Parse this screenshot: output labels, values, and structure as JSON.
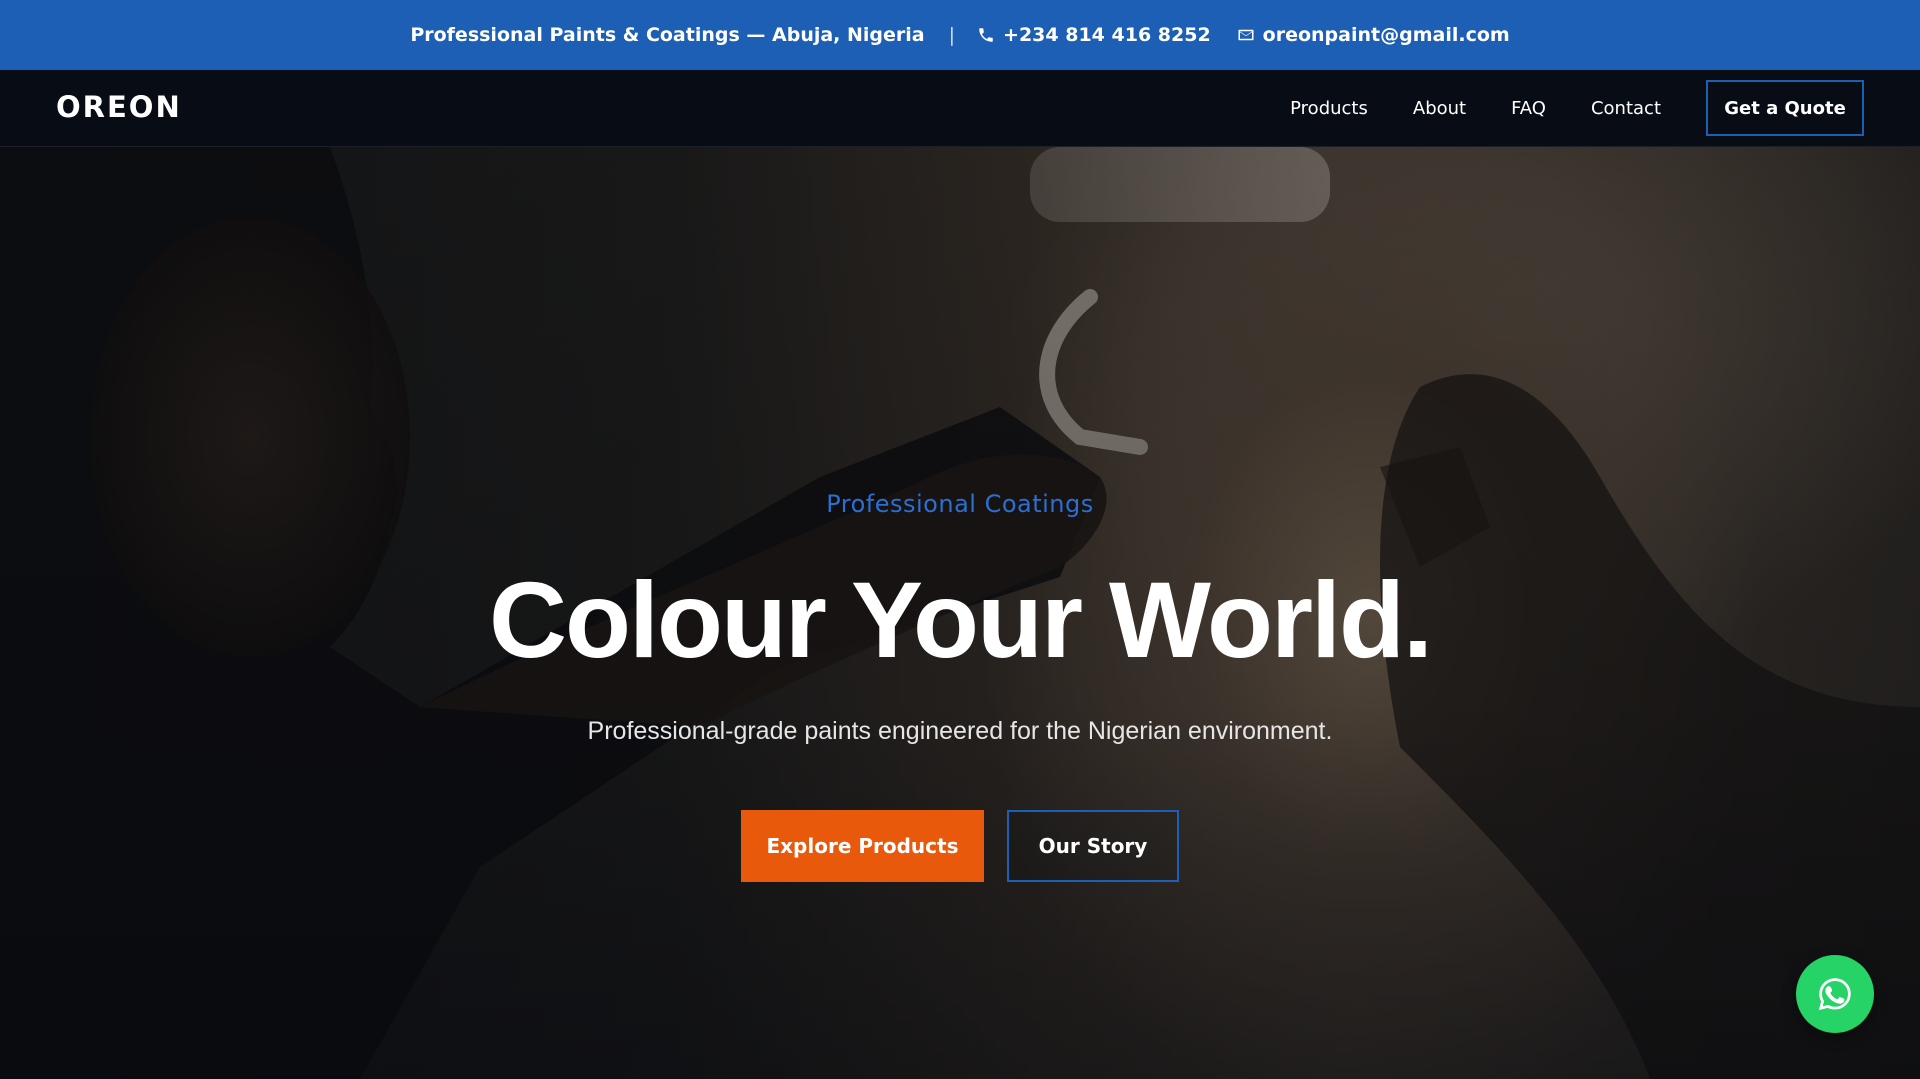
{
  "topbar": {
    "tagline": "Professional Paints & Coatings — Abuja, Nigeria",
    "separator": "|",
    "phone": "+234 814 416 8252",
    "phone_icon": "phone-icon",
    "email": "oreonpaint@gmail.com",
    "email_icon": "mail-icon",
    "background_color": "#1c5fb4"
  },
  "navbar": {
    "logo": "OREON",
    "links": [
      {
        "label": "Products"
      },
      {
        "label": "About"
      },
      {
        "label": "FAQ"
      },
      {
        "label": "Contact"
      }
    ],
    "quote_button": "Get a Quote"
  },
  "hero": {
    "eyebrow": "Professional Coatings",
    "headline": "Colour Your World.",
    "subline": "Professional-grade paints engineered for the Nigerian environment.",
    "primary_button": "Explore Products",
    "secondary_button": "Our Story",
    "accent_color": "#e8590c",
    "eyebrow_color": "#2a6fd1"
  },
  "floating": {
    "whatsapp_icon": "whatsapp-icon",
    "color": "#25d366"
  }
}
